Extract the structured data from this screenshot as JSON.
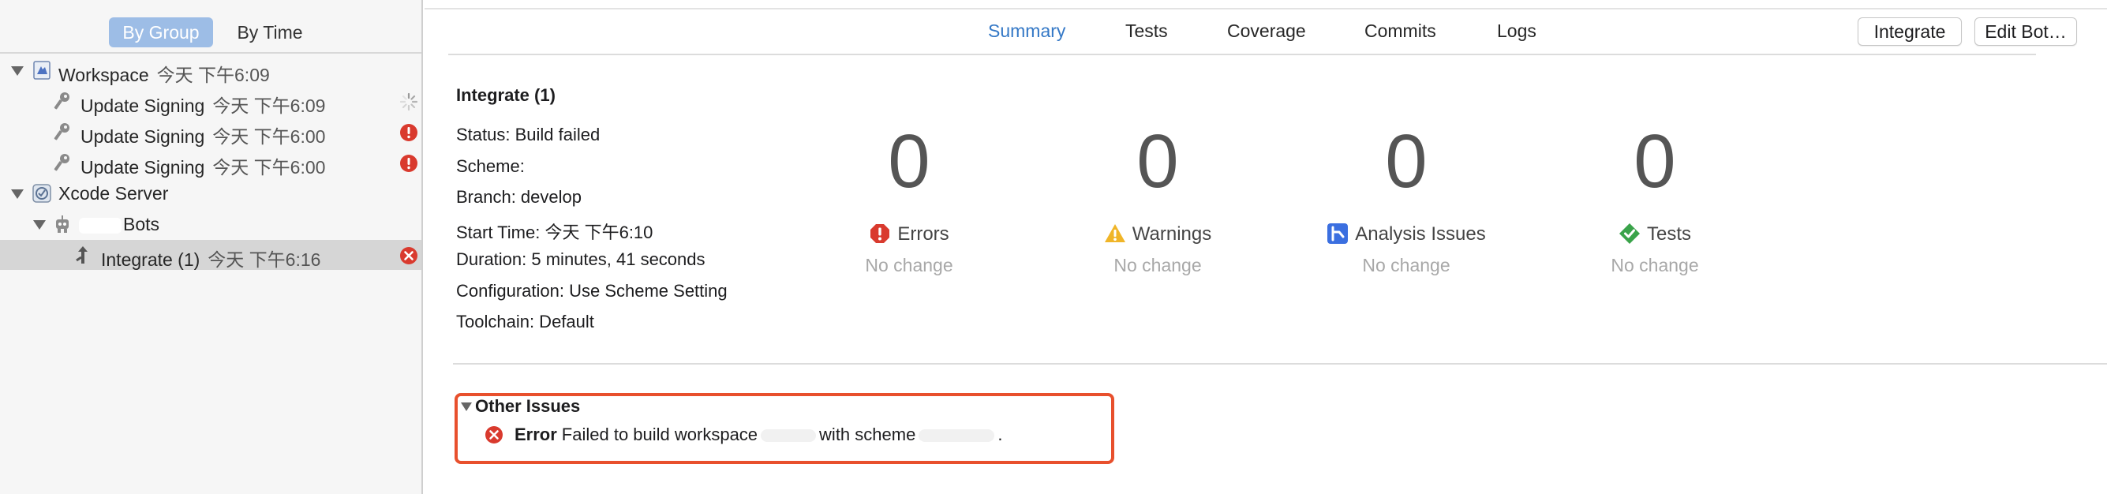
{
  "sidebar": {
    "segments": [
      {
        "label": "By Group",
        "active": true
      },
      {
        "label": "By Time",
        "active": false
      }
    ],
    "tree": [
      {
        "label": "Workspace",
        "time": "今天 下午6:09",
        "icon": "workspace-icon"
      },
      {
        "label": "Update Signing",
        "time": "今天 下午6:09",
        "icon": "key-icon",
        "status": "spinner-icon"
      },
      {
        "label": "Update Signing",
        "time": "今天 下午6:00",
        "icon": "key-icon",
        "status": "error-icon"
      },
      {
        "label": "Update Signing",
        "time": "今天 下午6:00",
        "icon": "key-icon",
        "status": "error-icon"
      },
      {
        "label": "Xcode Server",
        "time": "",
        "icon": "server-icon"
      },
      {
        "label": "Bots",
        "time": "",
        "icon": "robot-icon"
      },
      {
        "label": "Integrate (1)",
        "time": "今天 下午6:16",
        "icon": "integrate-icon",
        "status": "failed-icon"
      }
    ]
  },
  "tabs": [
    {
      "label": "Summary",
      "active": true
    },
    {
      "label": "Tests",
      "active": false
    },
    {
      "label": "Coverage",
      "active": false
    },
    {
      "label": "Commits",
      "active": false
    },
    {
      "label": "Logs",
      "active": false
    }
  ],
  "buttons": {
    "integrate": "Integrate",
    "edit_bot": "Edit Bot…"
  },
  "summary": {
    "title": "Integrate (1)",
    "status": "Status: Build failed",
    "scheme": "Scheme: ",
    "branch": "Branch: develop",
    "start_time": "Start Time: 今天 下午6:10",
    "duration": "Duration: 5 minutes, 41 seconds",
    "configuration": "Configuration: Use Scheme Setting",
    "toolchain": "Toolchain: Default"
  },
  "metrics": [
    {
      "value": "0",
      "label": "Errors",
      "sub": "No change",
      "icon": "error-icon",
      "color": "#d93a2e"
    },
    {
      "value": "0",
      "label": "Warnings",
      "sub": "No change",
      "icon": "warning-icon",
      "color": "#f0b528"
    },
    {
      "value": "0",
      "label": "Analysis Issues",
      "sub": "No change",
      "icon": "analysis-icon",
      "color": "#3b6fe0"
    },
    {
      "value": "0",
      "label": "Tests",
      "sub": "No change",
      "icon": "check-icon",
      "color": "#3aa34a"
    }
  ],
  "other_issues": {
    "title": "Other Issues",
    "kind": "Error",
    "message_prefix": "Failed to build workspace",
    "message_middle": "with scheme",
    "message_end": "."
  },
  "colors": {
    "accent": "#3478c6",
    "highlight_border": "#e8502d",
    "selected_row": "#d6d6d6"
  }
}
